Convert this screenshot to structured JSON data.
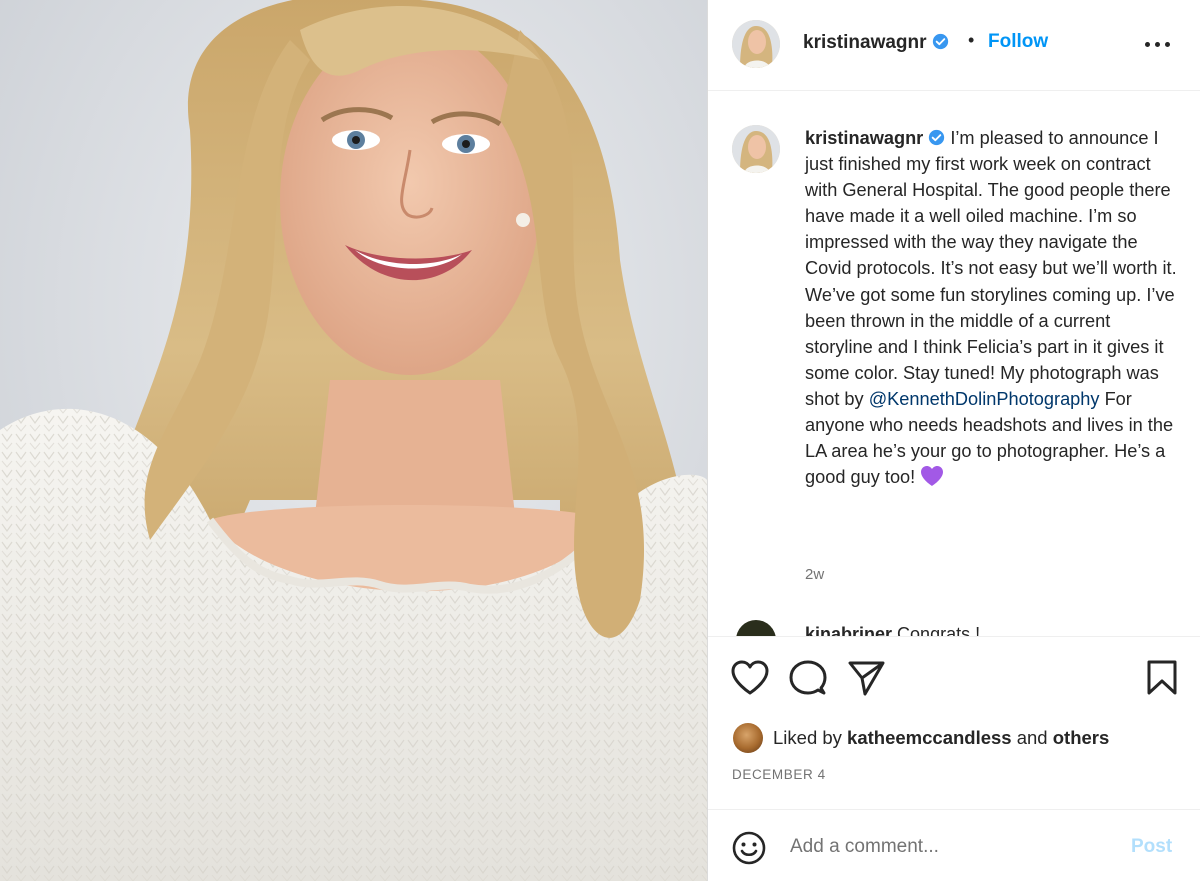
{
  "post": {
    "author": {
      "username": "kristinawagnr",
      "verified": true,
      "avatar_icon": "profile-avatar"
    },
    "header": {
      "separator": "•",
      "follow_label": "Follow",
      "more_icon": "more-options-icon"
    },
    "caption": {
      "username": "kristinawagnr",
      "text_before_mention": "I’m pleased to announce I just finished my first work week on contract with General Hospital. The good people there have made it a well oiled machine. I’m so impressed with the way they navigate the Covid protocols. It’s not easy but we’ll worth it. We’ve got some fun storylines coming up. I’ve been thrown in the middle of a current storyline and I think Felicia’s part in it gives it some color. Stay tuned! My photograph was shot by ",
      "mention": "@KennethDolinPhotography",
      "text_after_mention": " For anyone who needs headshots and lives in the LA area he’s your go to photographer. He’s a good guy too! ",
      "emoji": "purple-heart",
      "time_ago": "2w"
    },
    "next_comment": {
      "username": "kinabriner",
      "text": "Congrats !"
    },
    "actions": {
      "like_icon": "heart-icon",
      "comment_icon": "comment-icon",
      "share_icon": "share-icon",
      "save_icon": "bookmark-icon"
    },
    "likes": {
      "prefix": "Liked by",
      "user": "katheemccandless",
      "middle": "and",
      "suffix": "others"
    },
    "date": "DECEMBER 4",
    "comment_box": {
      "emoji_icon": "smiley-icon",
      "placeholder": "Add a comment...",
      "post_label": "Post"
    }
  },
  "colors": {
    "accent_blue": "#0095f6",
    "post_button_disabled": "#b2dffc",
    "mention": "#00376b",
    "secondary_text": "#737373",
    "verified_badge": "#3897f0",
    "heart_emoji": "#a259e6"
  }
}
